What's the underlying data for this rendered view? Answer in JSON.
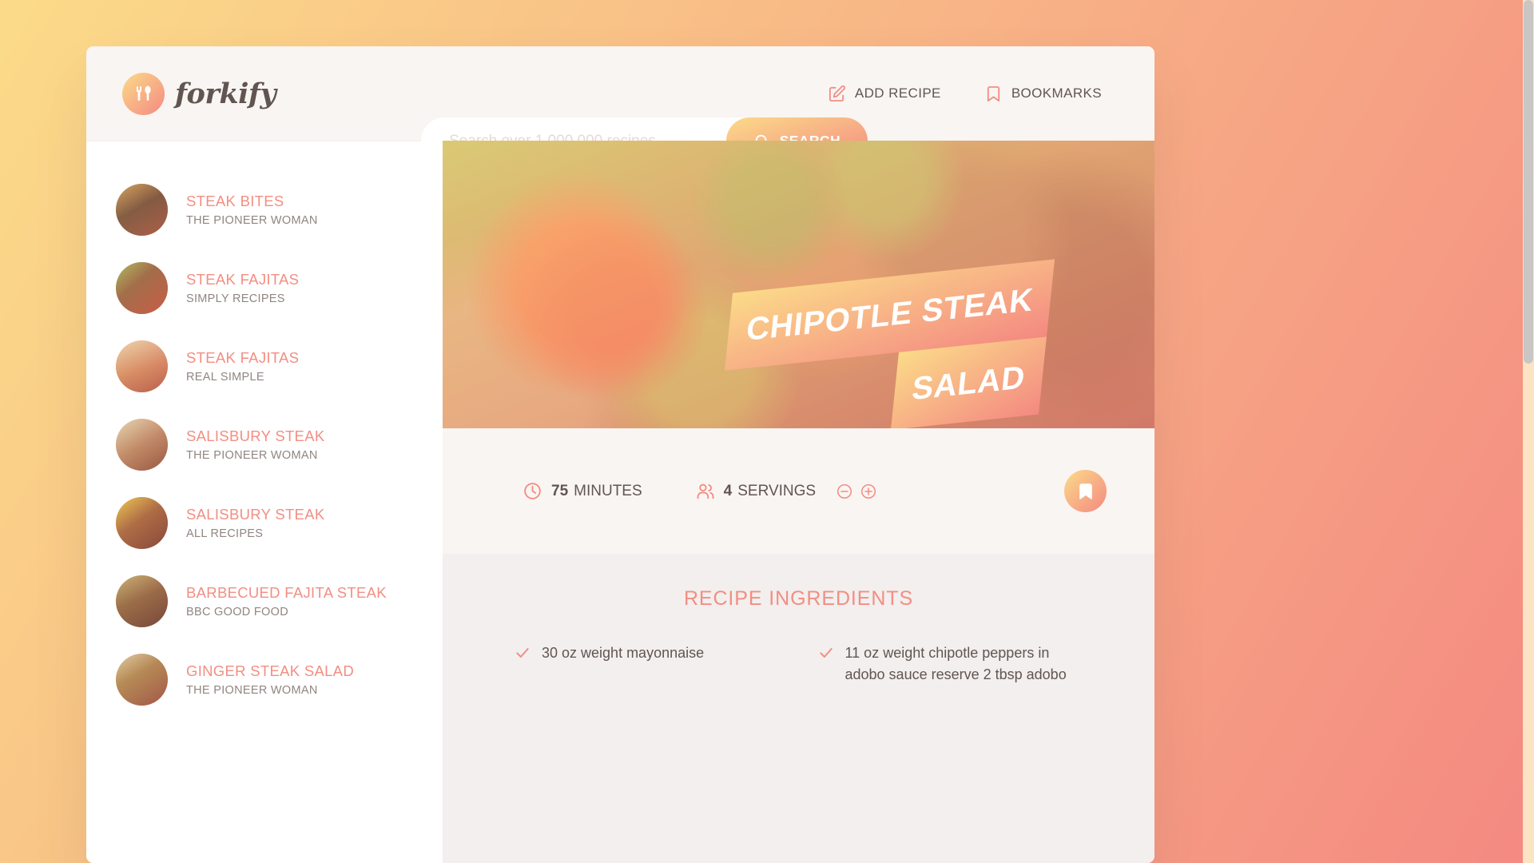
{
  "brand": {
    "name": "forkify",
    "logo_icon": "fork-spoon-icon"
  },
  "search": {
    "placeholder": "Search over 1,000,000 recipes...",
    "value": "",
    "button_label": "SEARCH",
    "button_icon": "search-icon"
  },
  "nav": {
    "add_recipe": {
      "label": "ADD RECIPE",
      "icon": "edit-square-icon"
    },
    "bookmarks": {
      "label": "BOOKMARKS",
      "icon": "bookmark-icon"
    }
  },
  "sidebar": {
    "results": [
      {
        "title": "STEAK BITES",
        "publisher": "THE PIONEER WOMAN"
      },
      {
        "title": "STEAK FAJITAS",
        "publisher": "SIMPLY RECIPES"
      },
      {
        "title": "STEAK FAJITAS",
        "publisher": "REAL SIMPLE"
      },
      {
        "title": "SALISBURY STEAK",
        "publisher": "THE PIONEER WOMAN"
      },
      {
        "title": "SALISBURY STEAK",
        "publisher": "ALL RECIPES"
      },
      {
        "title": "BARBECUED FAJITA STEAK",
        "publisher": "BBC GOOD FOOD"
      },
      {
        "title": "GINGER STEAK SALAD",
        "publisher": "THE PIONEER WOMAN"
      }
    ]
  },
  "recipe": {
    "title_line_1": "CHIPOTLE STEAK",
    "title_line_2": "SALAD",
    "time_value": "75",
    "time_unit": "MINUTES",
    "time_icon": "clock-icon",
    "servings_value": "4",
    "servings_unit": "SERVINGS",
    "servings_icon": "users-icon",
    "decrease_icon": "minus-circle-icon",
    "increase_icon": "plus-circle-icon",
    "bookmark_icon": "bookmark-icon",
    "ingredients_heading": "RECIPE INGREDIENTS",
    "check_icon": "check-icon",
    "ingredients": [
      "30 oz weight mayonnaise",
      "11 oz weight chipotle peppers in adobo sauce reserve 2 tbsp adobo"
    ]
  },
  "colors": {
    "accent": "#f38e82",
    "gradient_start": "#fbdb89",
    "gradient_end": "#f48982",
    "text": "#615551",
    "muted": "#918581",
    "panel": "#f9f5f3",
    "panel_alt": "#f2efee"
  }
}
